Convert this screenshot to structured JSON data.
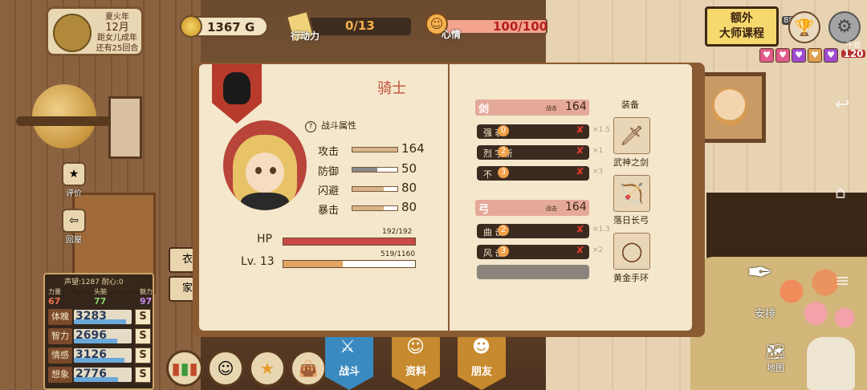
{
  "season": {
    "name": "夏火年",
    "month": "12月",
    "line1": "距女儿成年",
    "line2": "还有25回合"
  },
  "gold": {
    "value": "1367",
    "unit": "G"
  },
  "action_points": {
    "label": "行动力",
    "value": "0/13"
  },
  "mood": {
    "label": "心情",
    "value": "100/100"
  },
  "course_button": {
    "line1": "额外",
    "line2": "大师课程"
  },
  "badge": "88",
  "hearts": [
    "♥",
    "♥",
    "♥",
    "♥",
    "♥"
  ],
  "side_mood": {
    "label": "干劲",
    "value": "120"
  },
  "left_buttons": {
    "eval": "评价",
    "back": "回屋"
  },
  "closet_buttons": {
    "clothes": "衣",
    "home": "家"
  },
  "stats": {
    "top": "声望:1287  耐心:0",
    "trio": [
      {
        "label": "力量",
        "value": "67"
      },
      {
        "label": "头脑",
        "value": "77"
      },
      {
        "label": "魅力",
        "value": "97"
      }
    ],
    "rows": [
      {
        "label": "体魄",
        "value": "3283",
        "grade": "S"
      },
      {
        "label": "智力",
        "value": "2696",
        "grade": "S"
      },
      {
        "label": "情感",
        "value": "3126",
        "grade": "S"
      },
      {
        "label": "想象",
        "value": "2776",
        "grade": "S"
      }
    ]
  },
  "tabs": [
    {
      "label": "战斗"
    },
    {
      "label": "资料"
    },
    {
      "label": "朋友"
    }
  ],
  "book": {
    "class_title": "骑士",
    "attr_heading": "战斗属性",
    "attrs": [
      {
        "label": "攻击",
        "value": "164",
        "fill": 1.0
      },
      {
        "label": "防御",
        "value": "50",
        "fill": 0.55
      },
      {
        "label": "闪避",
        "value": "80",
        "fill": 0.7
      },
      {
        "label": "暴击",
        "value": "80",
        "fill": 0.7
      }
    ],
    "hp": {
      "label": "HP",
      "value": "192/192",
      "fill": 1.0
    },
    "lv": {
      "label": "Lv. 13",
      "value": "519/1160",
      "fill": 0.45
    },
    "sword": {
      "label": "剑",
      "score_label": "战击",
      "score": "164"
    },
    "sword_skills": [
      {
        "name": "强 袭",
        "level": "0",
        "mult": "×1.5"
      },
      {
        "name": "烈 字斩",
        "level": "2",
        "mult": "×1"
      },
      {
        "name": "不",
        "level": "3",
        "mult": "×3"
      }
    ],
    "bow": {
      "label": "弓",
      "score_label": "战击",
      "score": "164"
    },
    "bow_skills": [
      {
        "name": "曲 击",
        "level": "2",
        "mult": "×1.3"
      },
      {
        "name": "风 击",
        "level": "3",
        "mult": "×2"
      }
    ],
    "equip_heading": "装备",
    "equipment": [
      {
        "name": "武神之剑",
        "icon": "sword-icon"
      },
      {
        "name": "落日长弓",
        "icon": "bow-icon"
      },
      {
        "name": "黄金手环",
        "icon": "ring-icon"
      }
    ]
  },
  "right": {
    "arrange": "安排",
    "map": "地图"
  }
}
